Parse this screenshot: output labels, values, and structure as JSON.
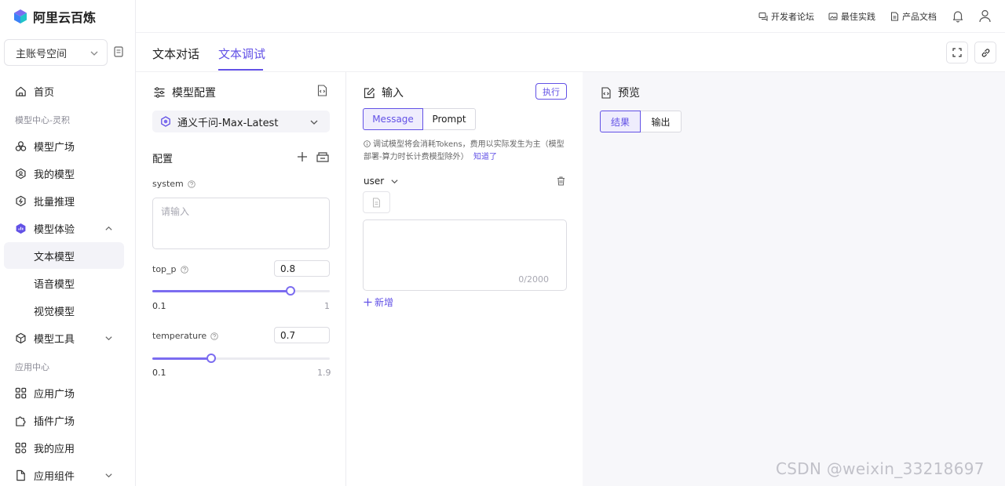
{
  "app": {
    "title": "阿里云百炼"
  },
  "sidebar": {
    "account_select": "主账号空间",
    "home": "首页",
    "group_model_center": "模型中心-灵积",
    "model_plaza": "模型广场",
    "my_models": "我的模型",
    "batch_inference": "批量推理",
    "model_experience": "模型体验",
    "text_model": "文本模型",
    "voice_model": "语音模型",
    "vision_model": "视觉模型",
    "model_tools": "模型工具",
    "group_app_center": "应用中心",
    "app_plaza": "应用广场",
    "plugin_plaza": "插件广场",
    "my_apps": "我的应用",
    "app_components": "应用组件"
  },
  "topbar": {
    "dev_forum": "开发者论坛",
    "best_practice": "最佳实践",
    "product_docs": "产品文档"
  },
  "tabs": {
    "chat": "文本对话",
    "debug": "文本调试",
    "active": "文本调试"
  },
  "config": {
    "title": "模型配置",
    "model_name": "通义千问-Max-Latest",
    "section": "配置",
    "system_label": "system",
    "system_placeholder": "请输入",
    "top_p_label": "top_p",
    "top_p_value": "0.8",
    "top_p_min": "0.1",
    "top_p_max": "1",
    "top_p_fraction": 0.78,
    "temperature_label": "temperature",
    "temperature_value": "0.7",
    "temperature_min": "0.1",
    "temperature_max": "1.9",
    "temperature_fraction": 0.33
  },
  "input": {
    "title": "输入",
    "run_label": "执行",
    "seg_message": "Message",
    "seg_prompt": "Prompt",
    "notice_text": "调试模型将会消耗Tokens，费用以实际发生为主（模型部署-算力时长计费模型除外）",
    "notice_link": "知道了",
    "role": "user",
    "counter": "0/2000",
    "add_label": "新增"
  },
  "preview": {
    "title": "预览",
    "seg_result": "结果",
    "seg_output": "输出"
  },
  "watermark": "CSDN @weixin_33218697",
  "colors": {
    "accent": "#6251e6",
    "slider": "#7b6cf0",
    "preview_bg": "#f7f7fa"
  }
}
